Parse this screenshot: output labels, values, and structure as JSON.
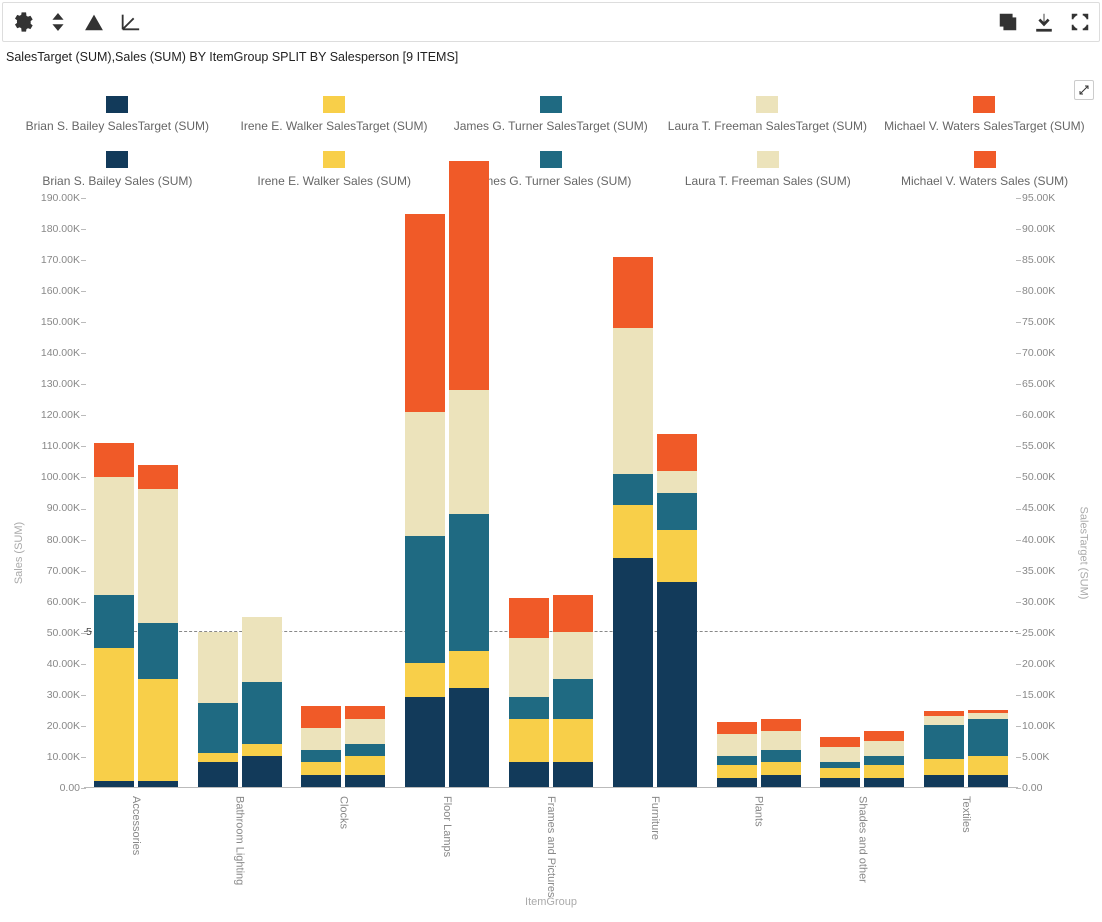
{
  "toolbar": {
    "icons": {
      "settings": "gear-icon",
      "sort": "sort-icon",
      "drillup": "drill-up-icon",
      "drilldown": "drill-down-icon",
      "copy": "copy-icon",
      "download": "download-icon",
      "fullscreen": "fullscreen-icon"
    }
  },
  "subtitle": "SalesTarget (SUM),Sales (SUM) BY ItemGroup SPLIT BY Salesperson [9 ITEMS]",
  "colors": {
    "brian": "#123a5a",
    "irene": "#f8cf49",
    "james": "#1f6a82",
    "laura": "#ece3bb",
    "michael": "#f05a28"
  },
  "legend": [
    {
      "label": "Brian S. Bailey SalesTarget (SUM)",
      "colorKey": "brian"
    },
    {
      "label": "Irene E. Walker SalesTarget (SUM)",
      "colorKey": "irene"
    },
    {
      "label": "James G. Turner SalesTarget (SUM)",
      "colorKey": "james"
    },
    {
      "label": "Laura T. Freeman SalesTarget (SUM)",
      "colorKey": "laura"
    },
    {
      "label": "Michael V. Waters SalesTarget (SUM)",
      "colorKey": "michael"
    },
    {
      "label": "Brian S. Bailey Sales (SUM)",
      "colorKey": "brian"
    },
    {
      "label": "Irene E. Walker Sales (SUM)",
      "colorKey": "irene"
    },
    {
      "label": "James G. Turner Sales (SUM)",
      "colorKey": "james"
    },
    {
      "label": "Laura T. Freeman Sales (SUM)",
      "colorKey": "laura"
    },
    {
      "label": "Michael V. Waters Sales (SUM)",
      "colorKey": "michael"
    }
  ],
  "chart_data": {
    "type": "bar",
    "stacked": true,
    "title": "",
    "xlabel": "ItemGroup",
    "y_left": {
      "label": "Sales (SUM)",
      "min": 0,
      "max": 190000,
      "ticks": [
        "190.00K",
        "180.00K",
        "170.00K",
        "160.00K",
        "150.00K",
        "140.00K",
        "130.00K",
        "120.00K",
        "110.00K",
        "100.00K",
        "90.00K",
        "80.00K",
        "70.00K",
        "60.00K",
        "50.00K",
        "40.00K",
        "30.00K",
        "20.00K",
        "10.00K",
        "0.00"
      ]
    },
    "y_right": {
      "label": "SalesTarget (SUM)",
      "min": 0,
      "max": 95000,
      "ticks": [
        "95.00K",
        "90.00K",
        "85.00K",
        "80.00K",
        "75.00K",
        "70.00K",
        "65.00K",
        "60.00K",
        "55.00K",
        "50.00K",
        "45.00K",
        "40.00K",
        "35.00K",
        "30.00K",
        "25.00K",
        "20.00K",
        "15.00K",
        "10.00K",
        "5.00K",
        "0.00"
      ]
    },
    "reference_line": {
      "value_left": 50000,
      "label": "5"
    },
    "categories": [
      "Accessories",
      "Bathroom Lighting",
      "Clocks",
      "Floor Lamps",
      "Frames and Pictures",
      "Furniture",
      "Plants",
      "Shades and other",
      "Textiles"
    ],
    "series_order": [
      "brian",
      "irene",
      "james",
      "laura",
      "michael"
    ],
    "salesTarget": {
      "Accessories": {
        "brian": 2000,
        "irene": 43000,
        "james": 17000,
        "laura": 38000,
        "michael": 11000
      },
      "Bathroom Lighting": {
        "brian": 8000,
        "irene": 3000,
        "james": 16000,
        "laura": 23000,
        "michael": 0
      },
      "Clocks": {
        "brian": 4000,
        "irene": 4000,
        "james": 4000,
        "laura": 7000,
        "michael": 7000
      },
      "Floor Lamps": {
        "brian": 29000,
        "irene": 11000,
        "james": 41000,
        "laura": 40000,
        "michael": 64000
      },
      "Frames and Pictures": {
        "brian": 8000,
        "irene": 14000,
        "james": 7000,
        "laura": 19000,
        "michael": 13000
      },
      "Furniture": {
        "brian": 74000,
        "irene": 17000,
        "james": 10000,
        "laura": 47000,
        "michael": 23000
      },
      "Plants": {
        "brian": 3000,
        "irene": 4000,
        "james": 3000,
        "laura": 7000,
        "michael": 4000
      },
      "Shades and other": {
        "brian": 3000,
        "irene": 3000,
        "james": 2000,
        "laura": 5000,
        "michael": 3000
      },
      "Textiles": {
        "brian": 4000,
        "irene": 5000,
        "james": 11000,
        "laura": 3000,
        "michael": 1500
      }
    },
    "sales": {
      "Accessories": {
        "brian": 1000,
        "irene": 16500,
        "james": 9000,
        "laura": 21500,
        "michael": 4000
      },
      "Bathroom Lighting": {
        "brian": 5000,
        "irene": 2000,
        "james": 10000,
        "laura": 10500,
        "michael": 0
      },
      "Clocks": {
        "brian": 2000,
        "irene": 3000,
        "james": 2000,
        "laura": 4000,
        "michael": 2000
      },
      "Floor Lamps": {
        "brian": 16000,
        "irene": 6000,
        "james": 22000,
        "laura": 20000,
        "michael": 37000
      },
      "Frames and Pictures": {
        "brian": 4000,
        "irene": 7000,
        "james": 6500,
        "laura": 7500,
        "michael": 6000
      },
      "Furniture": {
        "brian": 33000,
        "irene": 8500,
        "james": 6000,
        "laura": 3500,
        "michael": 6000
      },
      "Plants": {
        "brian": 2000,
        "irene": 2000,
        "james": 2000,
        "laura": 3000,
        "michael": 2000
      },
      "Shades and other": {
        "brian": 1500,
        "irene": 2000,
        "james": 1500,
        "laura": 2500,
        "michael": 1500
      },
      "Textiles": {
        "brian": 2000,
        "irene": 3000,
        "james": 6000,
        "laura": 1000,
        "michael": 500
      }
    }
  }
}
